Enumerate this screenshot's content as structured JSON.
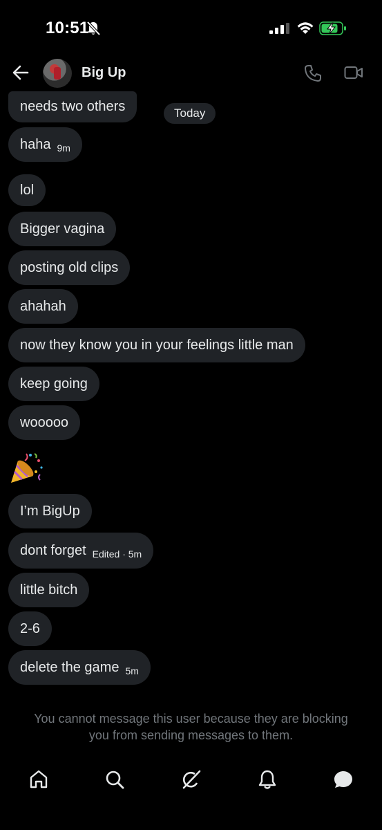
{
  "status_bar": {
    "time": "10:51",
    "battery_state": "charging",
    "signal_bars": 3
  },
  "header": {
    "contact_name": "Big Up",
    "icons": [
      "back-arrow-icon",
      "phone-icon",
      "video-call-icon"
    ]
  },
  "conversation": {
    "date_separator": "Today",
    "messages": [
      {
        "text": "needs two others",
        "meta": ""
      },
      {
        "text": "haha",
        "meta": "9m"
      },
      {
        "text": "lol",
        "meta": ""
      },
      {
        "text": "Bigger vagina",
        "meta": ""
      },
      {
        "text": "posting old clips",
        "meta": ""
      },
      {
        "text": "ahahah",
        "meta": ""
      },
      {
        "text": "now they know you in your feelings little man",
        "meta": ""
      },
      {
        "text": "keep going",
        "meta": ""
      },
      {
        "text": "wooooo",
        "meta": ""
      },
      {
        "text": "",
        "emoji": "party-popper-icon",
        "meta": ""
      },
      {
        "text": "I’m BigUp",
        "meta": ""
      },
      {
        "text": "dont forget",
        "meta": "Edited · 5m"
      },
      {
        "text": "little bitch",
        "meta": ""
      },
      {
        "text": "2-6",
        "meta": ""
      },
      {
        "text": "delete the game",
        "meta": "5m"
      }
    ]
  },
  "blocked_notice": {
    "line1": "You cannot message this user because they are blocking",
    "line2": "you from sending messages to them."
  },
  "bottom_nav": {
    "items": [
      "home-icon",
      "search-icon",
      "grok-icon",
      "notifications-icon",
      "messages-icon"
    ],
    "active": "messages-icon"
  },
  "colors": {
    "background": "#000000",
    "bubble": "#202327",
    "text": "#e7e9ea",
    "muted": "#71767b",
    "battery_green": "#34c759"
  }
}
